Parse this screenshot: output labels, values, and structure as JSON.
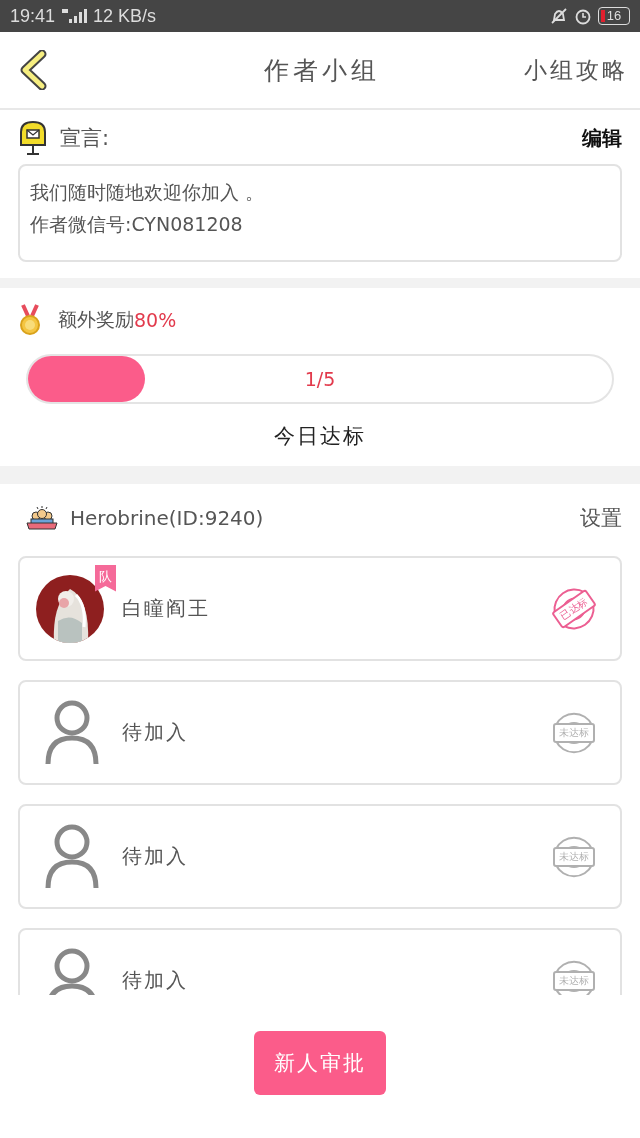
{
  "status_bar": {
    "time": "19:41",
    "speed": "12 KB/s",
    "battery": "16"
  },
  "header": {
    "title": "作者小组",
    "action": "小组攻略"
  },
  "manifesto": {
    "label": "宣言:",
    "edit": "编辑",
    "lines": [
      "我们随时随地欢迎你加入 。",
      "作者微信号:CYN081208"
    ]
  },
  "reward": {
    "label": "额外奖励",
    "bonus": "80%",
    "progress": {
      "level": 0.2,
      "reading": "1/5"
    },
    "caption": "今日达标"
  },
  "group": {
    "owner": "Herobrine(ID:9240)",
    "settings": "设置",
    "members": [
      {
        "kind": "member",
        "name": "白瞳阎王",
        "badge": "队",
        "reached": true,
        "stamp": "已达标"
      },
      {
        "kind": "vacant",
        "name": "待加入",
        "reached": false,
        "stamp": "未达标"
      },
      {
        "kind": "vacant",
        "name": "待加入",
        "reached": false,
        "stamp": "未达标"
      },
      {
        "kind": "vacant",
        "name": "待加入",
        "reached": false,
        "stamp": "未达标"
      }
    ]
  },
  "approve_button": "新人审批"
}
